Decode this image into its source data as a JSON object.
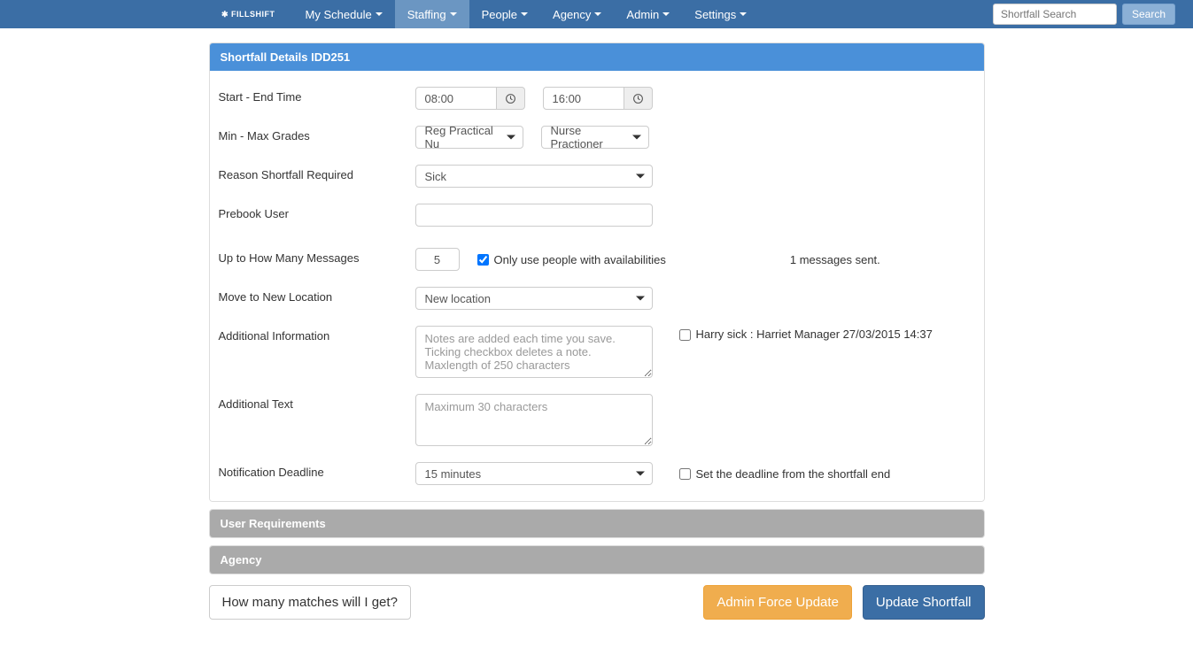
{
  "nav": {
    "brand": "✱ FILLSHIFT",
    "items": [
      {
        "label": "My Schedule",
        "active": false
      },
      {
        "label": "Staffing",
        "active": true
      },
      {
        "label": "People",
        "active": false
      },
      {
        "label": "Agency",
        "active": false
      },
      {
        "label": "Admin",
        "active": false
      },
      {
        "label": "Settings",
        "active": false
      }
    ],
    "search_placeholder": "Shortfall Search",
    "search_button": "Search"
  },
  "panel": {
    "title": "Shortfall Details IDD251"
  },
  "collapsed_panels": {
    "user_requirements": "User Requirements",
    "agency": "Agency"
  },
  "form": {
    "start_end_label": "Start - End Time",
    "start_time": "08:00",
    "end_time": "16:00",
    "min_max_label": "Min - Max Grades",
    "min_grade": "Reg Practical Nu",
    "max_grade": "Nurse Practioner",
    "reason_label": "Reason Shortfall Required",
    "reason_value": "Sick",
    "prebook_label": "Prebook User",
    "prebook_value": "",
    "messages_label": "Up to How Many Messages",
    "messages_value": "5",
    "only_availabilities_label": "Only use people with availabilities",
    "messages_sent": "1 messages sent.",
    "move_label": "Move to New Location",
    "move_value": "New location",
    "additional_info_label": "Additional Information",
    "additional_info_placeholder": "Notes are added each time you save. Ticking checkbox deletes a note. Maxlength of 250 characters",
    "note_text": "Harry sick : Harriet Manager 27/03/2015 14:37",
    "additional_text_label": "Additional Text",
    "additional_text_placeholder": "Maximum 30 characters",
    "deadline_label": "Notification Deadline",
    "deadline_value": "15 minutes",
    "deadline_checkbox_label": "Set the deadline from the shortfall end"
  },
  "actions": {
    "how_many": "How many matches will I get?",
    "admin_force": "Admin Force Update",
    "update": "Update Shortfall"
  }
}
